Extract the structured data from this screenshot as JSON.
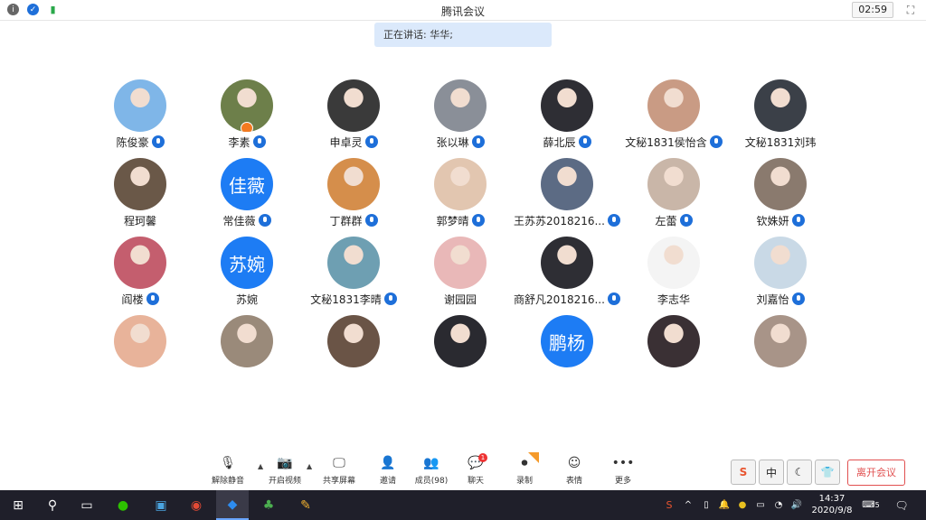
{
  "titlebar": {
    "title": "腾讯会议",
    "timer": "02:59"
  },
  "speaking": "正在讲话: 华华;",
  "participants": [
    [
      {
        "name": "陈俊豪",
        "type": "photo",
        "color": "#7fb6e8",
        "mic": true
      },
      {
        "name": "李素",
        "type": "photo",
        "color": "#6d7f4a",
        "mic": true,
        "host": true
      },
      {
        "name": "申卓灵",
        "type": "photo",
        "color": "#3a3a3a",
        "mic": true
      },
      {
        "name": "张以琳",
        "type": "photo",
        "color": "#8a8f98",
        "mic": true
      },
      {
        "name": "薛北辰",
        "type": "photo",
        "color": "#2e2e34",
        "mic": true
      },
      {
        "name": "文秘1831侯怡含",
        "type": "photo",
        "color": "#c99b84",
        "mic": true
      },
      {
        "name": "文秘1831刘玮",
        "type": "photo",
        "color": "#3b4048",
        "mic": false
      }
    ],
    [
      {
        "name": "程珂馨",
        "type": "photo",
        "color": "#6a5848",
        "mic": false
      },
      {
        "name": "常佳薇",
        "type": "text",
        "text": "佳薇",
        "mic": true
      },
      {
        "name": "丁群群",
        "type": "photo",
        "color": "#d58e4b",
        "mic": true
      },
      {
        "name": "郭梦晴",
        "type": "photo",
        "color": "#e2c6b0",
        "mic": true
      },
      {
        "name": "王苏苏2018216...",
        "type": "photo",
        "color": "#5c6b84",
        "mic": true
      },
      {
        "name": "左蕾",
        "type": "photo",
        "color": "#c9b6a8",
        "mic": true
      },
      {
        "name": "钦姝妍",
        "type": "photo",
        "color": "#8a7a6e",
        "mic": true
      }
    ],
    [
      {
        "name": "阎楼",
        "type": "photo",
        "color": "#c45e6e",
        "mic": true
      },
      {
        "name": "苏婉",
        "type": "text",
        "text": "苏婉",
        "mic": false
      },
      {
        "name": "文秘1831李晴",
        "type": "photo",
        "color": "#6e9fb2",
        "mic": true
      },
      {
        "name": "谢园园",
        "type": "photo",
        "color": "#e9b8b8",
        "mic": false
      },
      {
        "name": "商舒凡2018216...",
        "type": "photo",
        "color": "#2e2e34",
        "mic": true
      },
      {
        "name": "李志华",
        "type": "photo",
        "color": "#f4f4f4",
        "mic": false
      },
      {
        "name": "刘嘉怡",
        "type": "photo",
        "color": "#c9d9e6",
        "mic": true
      }
    ],
    [
      {
        "name": "",
        "type": "photo",
        "color": "#e8b39a",
        "mic": false
      },
      {
        "name": "",
        "type": "photo",
        "color": "#9a8a7a",
        "mic": false
      },
      {
        "name": "",
        "type": "photo",
        "color": "#6a5446",
        "mic": false
      },
      {
        "name": "",
        "type": "photo",
        "color": "#2a2a30",
        "mic": false
      },
      {
        "name": "",
        "type": "text",
        "text": "鹏杨",
        "mic": false
      },
      {
        "name": "",
        "type": "photo",
        "color": "#3a3034",
        "mic": false
      },
      {
        "name": "",
        "type": "photo",
        "color": "#a89488",
        "mic": false
      }
    ]
  ],
  "toolbar": {
    "unmute": "解除静音",
    "video": "开启视频",
    "share": "共享屏幕",
    "invite": "邀请",
    "members": "成员(98)",
    "chat": "聊天",
    "chat_badge": "1",
    "record": "录制",
    "emoji": "表情",
    "more": "更多"
  },
  "ime": [
    "S",
    "中",
    "☾",
    "👕"
  ],
  "leave": "离开会议",
  "taskbar": {
    "time": "14:37",
    "date": "2020/9/8",
    "notif_count": "5"
  }
}
